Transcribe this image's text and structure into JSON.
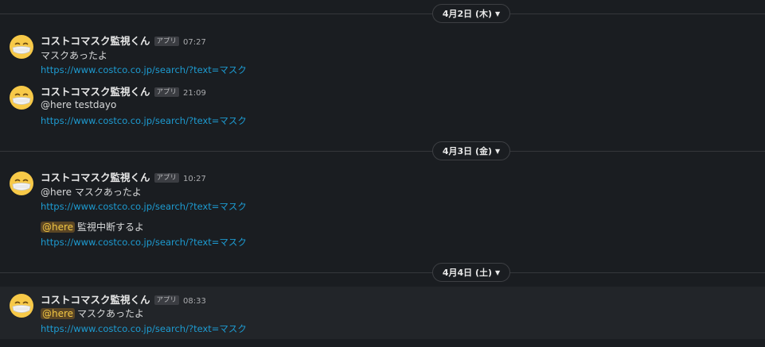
{
  "dividers": [
    {
      "label": "4月2日 (木)"
    },
    {
      "label": "4月3日 (金)"
    },
    {
      "label": "4月4日 (土)"
    }
  ],
  "sender": {
    "name": "コストコマスク監視くん",
    "badge": "アプリ",
    "avatar_icon": "face-with-mask-icon"
  },
  "mention": "@here",
  "messages": [
    {
      "time": "07:27",
      "text": "マスクあったよ",
      "link": "https://www.costco.co.jp/search/?text=マスク"
    },
    {
      "time": "21:09",
      "text": "@here testdayo",
      "link": "https://www.costco.co.jp/search/?text=マスク"
    },
    {
      "time": "10:27",
      "text": "@here マスクあったよ",
      "link": "https://www.costco.co.jp/search/?text=マスク",
      "followup_text": "監視中断するよ",
      "followup_link": "https://www.costco.co.jp/search/?text=マスク"
    },
    {
      "time": "08:33",
      "text": "マスクあったよ",
      "link": "https://www.costco.co.jp/search/?text=マスク"
    }
  ],
  "colors": {
    "background": "#1a1d21",
    "link": "#1d9bd1",
    "mention_bg": "#5a4524",
    "mention_fg": "#f2c744"
  }
}
